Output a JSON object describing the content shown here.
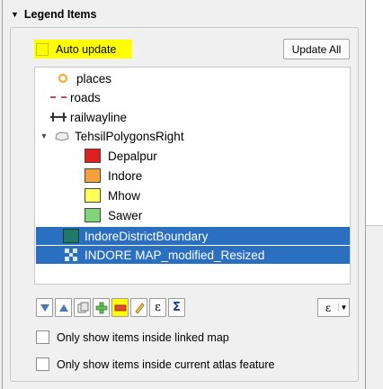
{
  "group_title": "Legend Items",
  "auto_update_label": "Auto update",
  "update_all_label": "Update All",
  "tree": [
    {
      "label": "places",
      "symbol": "circle-icon",
      "color": "#f5a623"
    },
    {
      "label": "roads",
      "symbol": "dashed-line-icon",
      "color": "#c0504d"
    },
    {
      "label": "railwayline",
      "symbol": "railway-icon",
      "color": "#333333"
    },
    {
      "label": "TehsilPolygonsRight",
      "symbol": "polygon-icon",
      "expanded": true
    },
    {
      "label": "Depalpur",
      "color": "#e0201e"
    },
    {
      "label": "Indore",
      "color": "#f5a03a"
    },
    {
      "label": "Mhow",
      "color": "#ffff55"
    },
    {
      "label": "Sawer",
      "color": "#7fd67a"
    },
    {
      "label": "IndoreDistrictBoundary",
      "color": "#1e7a6a",
      "selected": true
    },
    {
      "label": "INDORE MAP_modified_Resized",
      "symbol": "raster-icon",
      "selected": true
    }
  ],
  "toolbar": {
    "buttons": [
      "move-down-icon",
      "move-up-icon",
      "group-icon",
      "add-icon",
      "remove-icon",
      "edit-icon",
      "expression-icon",
      "sum-icon"
    ],
    "right_button": "expression-filter-icon",
    "highlight": "#ffff00"
  },
  "options": {
    "linked_map": "Only show items inside linked map",
    "atlas_feature": "Only show items inside current atlas feature"
  }
}
